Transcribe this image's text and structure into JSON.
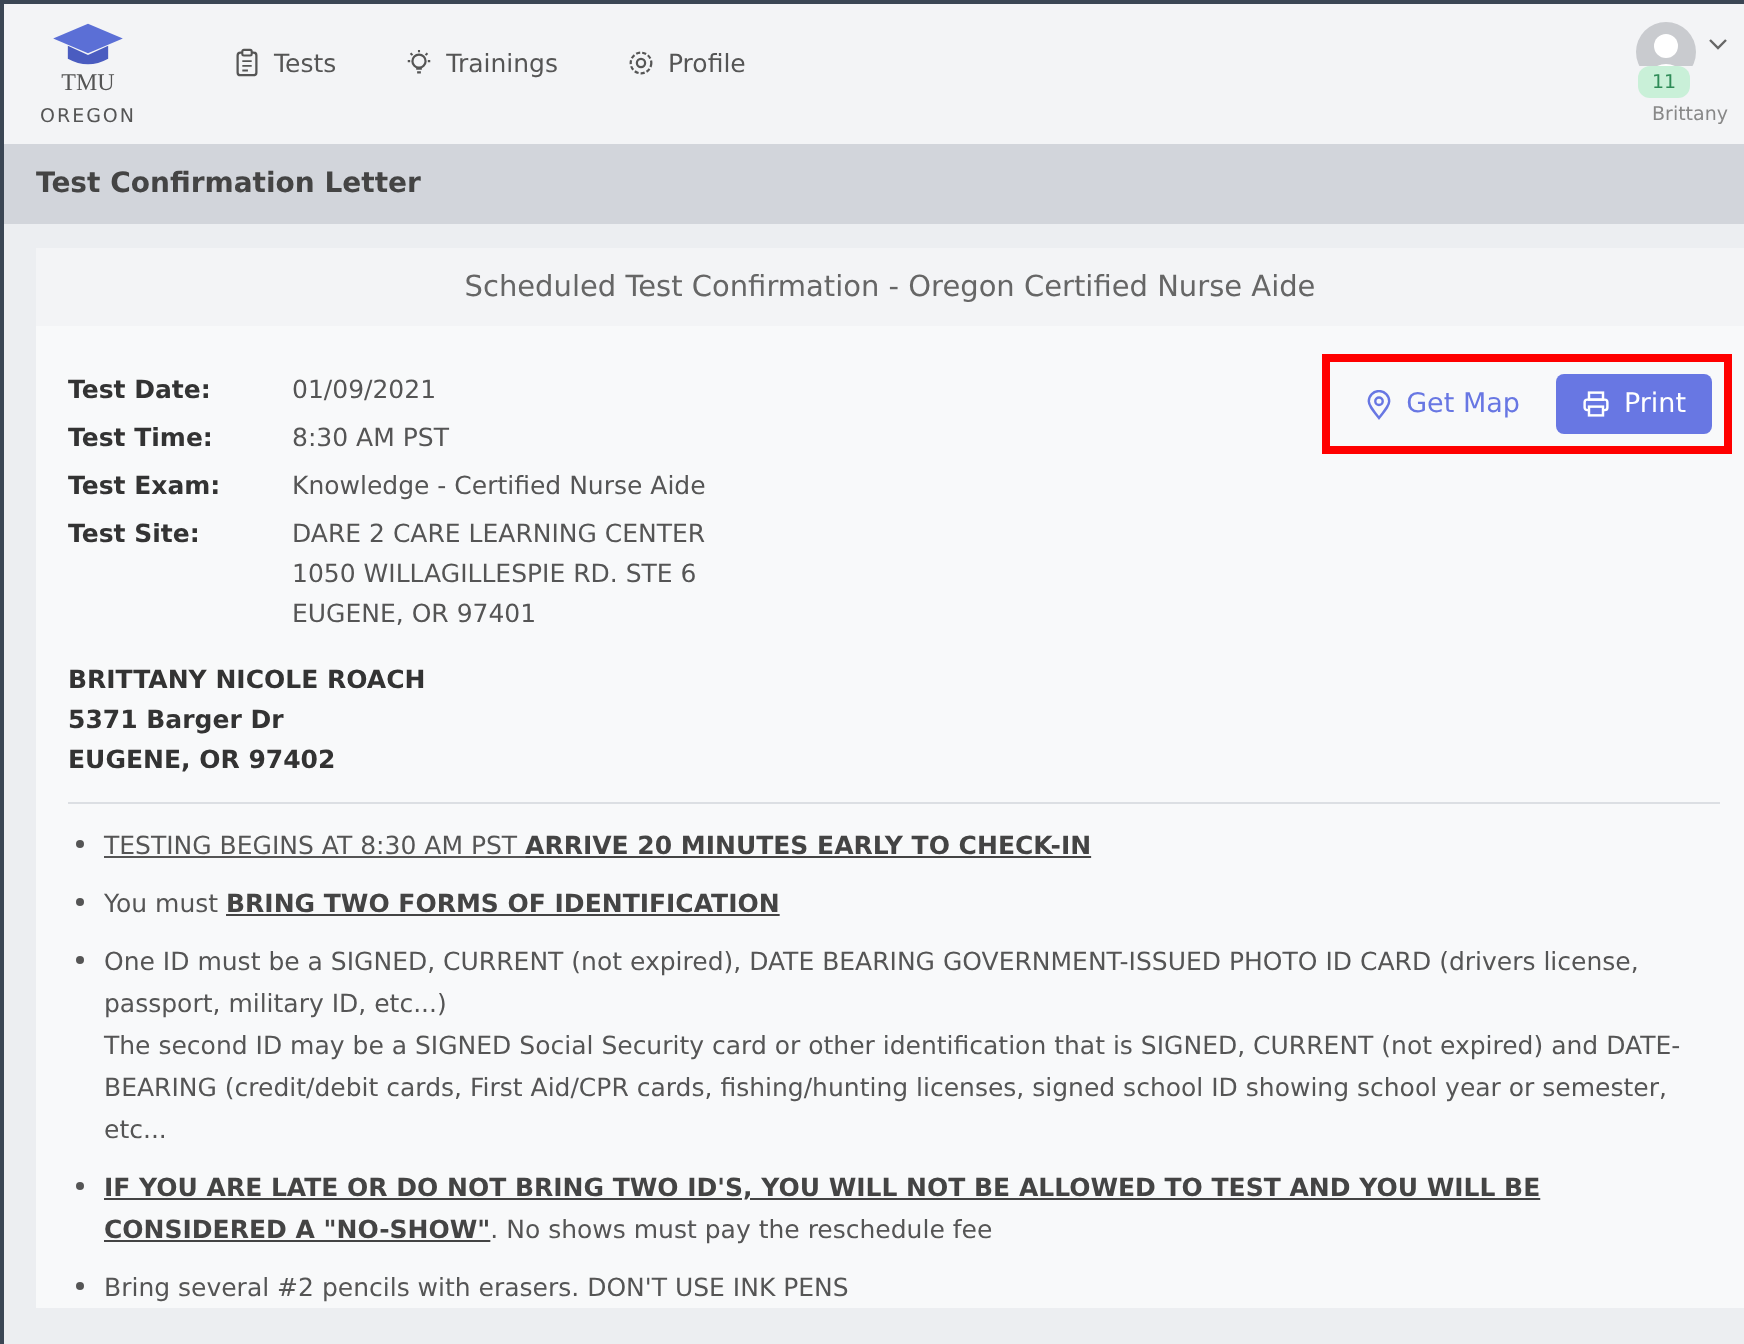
{
  "header": {
    "logo_text": "TMU",
    "logo_subtext": "OREGON",
    "nav": [
      {
        "label": "Tests"
      },
      {
        "label": "Trainings"
      },
      {
        "label": "Profile"
      }
    ],
    "user": {
      "badge": "11",
      "name": "Brittany"
    }
  },
  "page_title": "Test Confirmation Letter",
  "letter": {
    "heading": "Scheduled Test Confirmation - Oregon Certified Nurse Aide",
    "actions": {
      "map": "Get Map",
      "print": "Print",
      "highlighted": true
    },
    "details": [
      {
        "label": "Test Date:",
        "lines": [
          "01/09/2021"
        ]
      },
      {
        "label": "Test Time:",
        "lines": [
          "8:30 AM PST"
        ]
      },
      {
        "label": "Test Exam:",
        "lines": [
          "Knowledge - Certified Nurse Aide"
        ]
      },
      {
        "label": "Test Site:",
        "lines": [
          "DARE 2 CARE LEARNING CENTER",
          "1050 WILLAGILLESPIE RD. STE 6",
          "EUGENE, OR 97401"
        ]
      }
    ],
    "address": [
      "BRITTANY NICOLE ROACH",
      "5371 Barger Dr",
      "EUGENE, OR 97402"
    ],
    "instructions": [
      {
        "paragraphs": [
          [
            {
              "text": "TESTING BEGINS AT 8:30 AM PST ",
              "bold": false,
              "underline": true
            },
            {
              "text": "ARRIVE 20 MINUTES EARLY TO CHECK-IN",
              "bold": true,
              "underline": true
            }
          ]
        ]
      },
      {
        "paragraphs": [
          [
            {
              "text": "You must ",
              "bold": false,
              "underline": false
            },
            {
              "text": "BRING TWO FORMS OF IDENTIFICATION",
              "bold": true,
              "underline": true
            }
          ]
        ]
      },
      {
        "paragraphs": [
          [
            {
              "text": "One ID must be a SIGNED, CURRENT (not expired), DATE BEARING GOVERNMENT-ISSUED PHOTO ID CARD (drivers license, passport, military ID, etc...)",
              "bold": false,
              "underline": false
            }
          ],
          [
            {
              "text": "The second ID may be a SIGNED Social Security card or other identification that is SIGNED, CURRENT (not expired) and DATE-BEARING (credit/debit cards, First Aid/CPR cards, fishing/hunting licenses, signed school ID showing school year or semester, etc...",
              "bold": false,
              "underline": false
            }
          ]
        ]
      },
      {
        "paragraphs": [
          [
            {
              "text": "IF YOU ARE LATE OR DO NOT BRING TWO ID'S, YOU WILL NOT BE ALLOWED TO TEST AND YOU WILL BE CONSIDERED A \"NO-SHOW\"",
              "bold": true,
              "underline": true
            },
            {
              "text": ". No shows must pay the reschedule fee",
              "bold": false,
              "underline": false
            }
          ]
        ]
      },
      {
        "paragraphs": [
          [
            {
              "text": "Bring several #2 pencils with erasers. DON'T USE INK PENS",
              "bold": false,
              "underline": false
            }
          ]
        ]
      }
    ]
  }
}
